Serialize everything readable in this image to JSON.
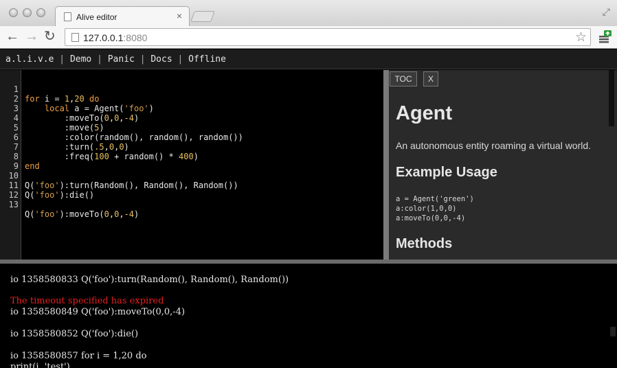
{
  "browser": {
    "tab_title": "Alive editor",
    "tab_close": "×",
    "url_host": "127.0.0.1",
    "url_port": ":8080",
    "back": "←",
    "forward": "→",
    "reload": "↻",
    "star": "☆",
    "fullscreen": "⤢"
  },
  "menu": {
    "brand": "a.l.i.v.e",
    "separator": "|",
    "items": [
      "Demo",
      "Panic",
      "Docs",
      "Offline"
    ]
  },
  "editor": {
    "line_numbers": [
      "1",
      "2",
      "3",
      "4",
      "5",
      "6",
      "7",
      "8",
      "9",
      "10",
      "11",
      "12",
      "13"
    ]
  },
  "docs": {
    "toc_button": "TOC",
    "close_button": "X",
    "title": "Agent",
    "description": "An autonomous entity roaming a virtual world.",
    "example_heading": "Example Usage",
    "example_code": [
      "a = Agent('green')",
      "a:color(1,0,0)",
      "a:moveTo(0,0,-4)"
    ],
    "methods_heading": "Methods"
  },
  "console": {
    "lines": [
      {
        "text": "io 1358580833 Q('foo'):turn(Random(), Random(), Random())",
        "type": "out"
      },
      {
        "text": "",
        "type": "out"
      },
      {
        "text": "The timeout specified has expired",
        "type": "error"
      },
      {
        "text": "io 1358580849 Q('foo'):moveTo(0,0,-4)",
        "type": "out"
      },
      {
        "text": "",
        "type": "out"
      },
      {
        "text": "io 1358580852 Q('foo'):die()",
        "type": "out"
      },
      {
        "text": "",
        "type": "out"
      },
      {
        "text": "io 1358580857 for i = 1,20 do",
        "type": "out"
      },
      {
        "text": "print(i, 'test')",
        "type": "out"
      }
    ]
  },
  "colors": {
    "keyword": "#f0a040",
    "string": "#d6a04a",
    "number": "#e8c060",
    "error": "#e52020"
  }
}
